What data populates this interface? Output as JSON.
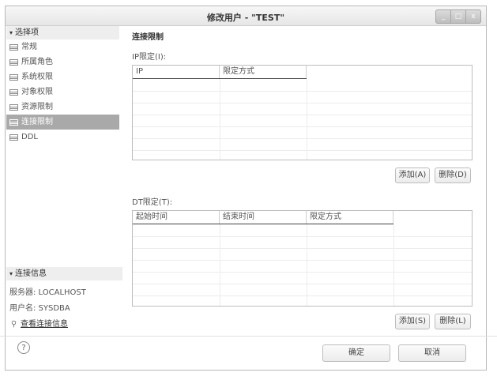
{
  "window": {
    "title": "修改用户 - \"TEST\"",
    "controls": [
      "_",
      "□",
      "x"
    ]
  },
  "sidebar": {
    "section_label": "选择项",
    "items": [
      {
        "label": "常规"
      },
      {
        "label": "所属角色"
      },
      {
        "label": "系统权限"
      },
      {
        "label": "对象权限"
      },
      {
        "label": "资源限制"
      },
      {
        "label": "连接限制"
      },
      {
        "label": "DDL"
      }
    ],
    "active_index": 5
  },
  "connection_info": {
    "section_label": "连接信息",
    "server_label": "服务器: LOCALHOST",
    "user_label": "用户名: SYSDBA",
    "view_link": "查看连接信息"
  },
  "main": {
    "title": "连接限制",
    "ip_section": {
      "label": "IP限定(I):",
      "columns": [
        "IP",
        "限定方式"
      ],
      "add_button": "添加(A)",
      "delete_button": "删除(D)"
    },
    "dt_section": {
      "label": "DT限定(T):",
      "columns": [
        "起始时间",
        "结束时间",
        "限定方式"
      ],
      "add_button": "添加(S)",
      "delete_button": "删除(L)"
    }
  },
  "footer": {
    "help_icon": "?",
    "ok_button": "确定",
    "cancel_button": "取消"
  },
  "icons": {
    "nav": "table-icon",
    "link": "connection-link-icon",
    "help": "help-icon"
  }
}
